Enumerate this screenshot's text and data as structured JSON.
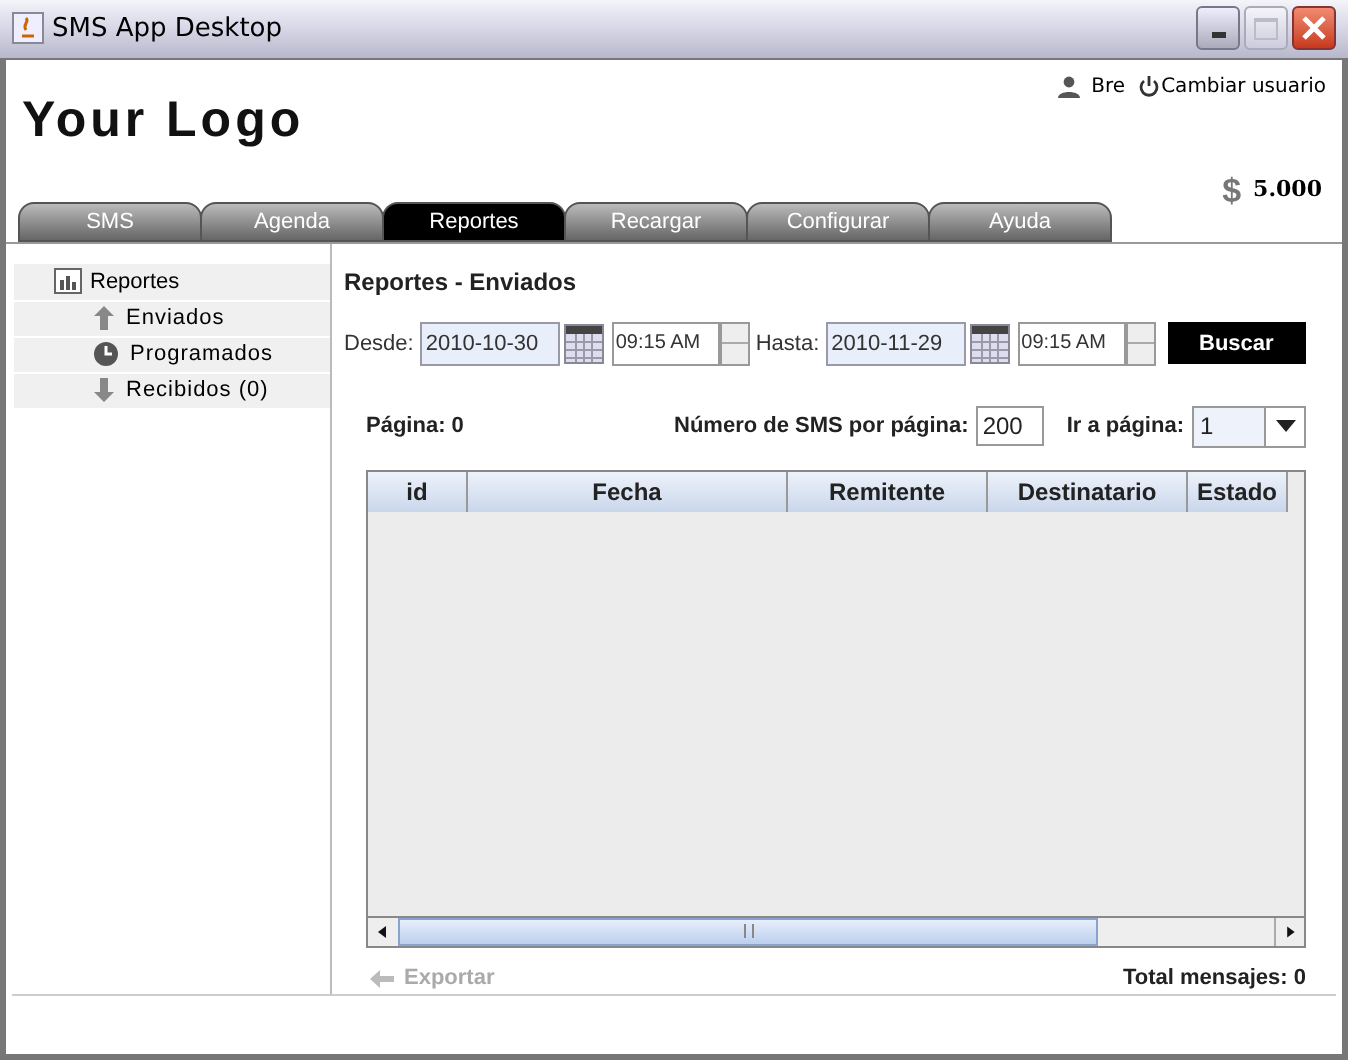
{
  "window": {
    "title": "SMS App Desktop"
  },
  "header": {
    "logo": "Your Logo",
    "user": "Bre",
    "switch_user": "Cambiar usuario",
    "currency": "$",
    "balance": "5.000"
  },
  "tabs": [
    {
      "label": "SMS",
      "selected": false
    },
    {
      "label": "Agenda",
      "selected": false
    },
    {
      "label": "Reportes",
      "selected": true
    },
    {
      "label": "Recargar",
      "selected": false
    },
    {
      "label": "Configurar",
      "selected": false
    },
    {
      "label": "Ayuda",
      "selected": false
    }
  ],
  "sidebar": {
    "items": [
      {
        "label": "Reportes",
        "kind": "chart",
        "children": [
          {
            "label": "Enviados",
            "kind": "up"
          },
          {
            "label": "Programados",
            "kind": "clock"
          },
          {
            "label": "Recibidos (0)",
            "kind": "down"
          }
        ]
      }
    ]
  },
  "section_title": "Reportes - Enviados",
  "filters": {
    "from_label": "Desde:",
    "from_date": "2010-10-30",
    "from_time": "09:15 AM",
    "to_label": "Hasta:",
    "to_date": "2010-11-29",
    "to_time": "09:15 AM",
    "search_button": "Buscar"
  },
  "pagination": {
    "page": "Página: 0",
    "per_page_label": "Número de SMS por página:",
    "per_page": "200",
    "goto_label": "Ir a página:",
    "goto_value": "1"
  },
  "table": {
    "columns": [
      "id",
      "Fecha",
      "Remitente",
      "Destinatario",
      "Estado"
    ]
  },
  "export": {
    "label": "Exportar",
    "disabled": true
  },
  "total": "Total mensajes: 0"
}
